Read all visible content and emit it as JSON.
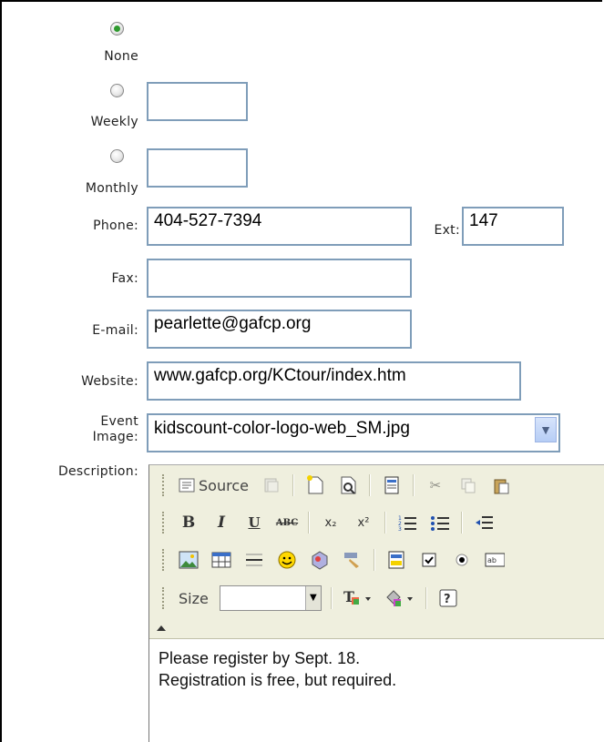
{
  "recurrence": {
    "options": [
      {
        "label": "None",
        "selected": true
      },
      {
        "label": "Weekly",
        "selected": false
      },
      {
        "label": "Monthly",
        "selected": false
      }
    ],
    "weekly_value": "",
    "monthly_value": ""
  },
  "contact": {
    "phone_label": "Phone:",
    "phone_value": "404-527-7394",
    "ext_label": "Ext:",
    "ext_value": "147",
    "fax_label": "Fax:",
    "fax_value": "",
    "email_label": "E-mail:",
    "email_value": "pearlette@gafcp.org",
    "website_label": "Website:",
    "website_value": "www.gafcp.org/KCtour/index.htm"
  },
  "event_image": {
    "label_line1": "Event",
    "label_line2": "Image:",
    "selected": "kidscount-color-logo-web_SM.jpg"
  },
  "description": {
    "label": "Description:",
    "toolbar": {
      "source_label": "Source",
      "bold": "B",
      "italic": "I",
      "underline": "U",
      "strike": "ABC",
      "subscript": "x₂",
      "superscript": "x²",
      "size_label": "Size",
      "size_value": ""
    },
    "content_lines": [
      "Please register by Sept. 18.",
      "Registration is free, but required."
    ]
  }
}
